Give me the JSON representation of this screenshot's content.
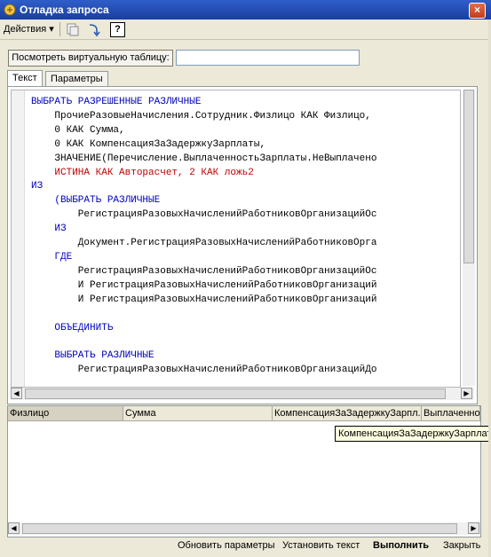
{
  "window": {
    "title": "Отладка запроса",
    "close_label": "×"
  },
  "toolbar": {
    "actions_label": "Действия ▾",
    "help_label": "?"
  },
  "virtual_table": {
    "button_label": "Посмотреть виртуальную таблицу:",
    "input_value": ""
  },
  "tabs": [
    {
      "label": "Текст"
    },
    {
      "label": "Параметры"
    }
  ],
  "query_lines": [
    "ВЫБРАТЬ РАЗРЕШЕННЫЕ РАЗЛИЧНЫЕ",
    "    ПрочиеРазовыеНачисления.Сотрудник.Физлицо КАК Физлицо,",
    "    0 КАК Сумма,",
    "    0 КАК КомпенсацияЗаЗадержкуЗарплаты,",
    "    ЗНАЧЕНИЕ(Перечисление.ВыплаченностьЗарплаты.НеВыплачено",
    "    ИСТИНА КАК Авторасчет, 2 КАК ложь2",
    "ИЗ",
    "    (ВЫБРАТЬ РАЗЛИЧНЫЕ",
    "        РегистрацияРазовыхНачисленийРаботниковОрганизацийОс",
    "    ИЗ",
    "        Документ.РегистрацияРазовыхНачисленийРаботниковОрга",
    "    ГДЕ",
    "        РегистрацияРазовыхНачисленийРаботниковОрганизацийОс",
    "        И РегистрацияРазовыхНачисленийРаботниковОрганизаций",
    "        И РегистрацияРазовыхНачисленийРаботниковОрганизаций",
    "",
    "    ОБЪЕДИНИТЬ",
    "",
    "    ВЫБРАТЬ РАЗЛИЧНЫЕ",
    "        РегистрацияРазовыхНачисленийРаботниковОрганизацийДо"
  ],
  "result_columns": [
    "Физлицо",
    "Сумма",
    "КомпенсацияЗаЗадержкуЗарпл...",
    "Выплаченно"
  ],
  "tooltip": "КомпенсацияЗаЗадержкуЗарплаты",
  "bottom_buttons": {
    "update_params": "Обновить параметры",
    "set_text": "Установить текст",
    "execute": "Выполнить",
    "close": "Закрыть"
  },
  "colors": {
    "keyword": "#0000c0",
    "literal_true": "#c00000",
    "number": "#c800c8",
    "title_bar": "#2456c4"
  }
}
